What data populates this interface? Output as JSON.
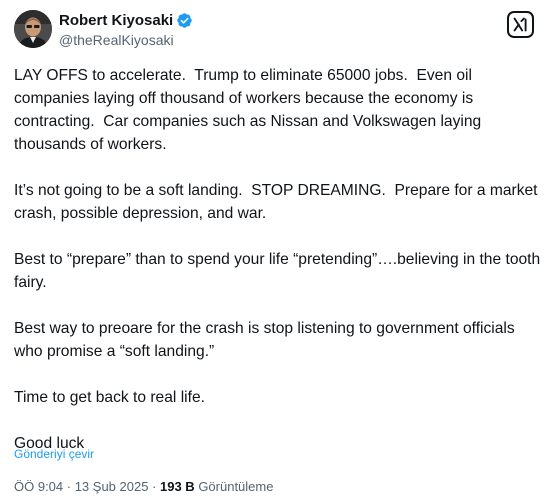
{
  "author": {
    "display_name": "Robert Kiyosaki",
    "handle": "@theRealKiyosaki",
    "verified_color": "#1d9bf0"
  },
  "header": {
    "grok_icon": "grok-icon"
  },
  "tweet": {
    "paragraphs": [
      "LAY OFFS to accelerate.  Trump to eliminate 65000 jobs.  Even oil companies laying off thousand of workers because the economy is contracting.  Car companies such as Nissan and Volkswagen laying thousands of workers.",
      "It’s not going to be a soft landing.  STOP DREAMING.  Prepare for a market crash, possible depression, and war.",
      "Best to “prepare” than to spend your life “pretending”….believing in the tooth fairy.",
      "Best way to preoare for the crash is stop listening to government officials who promise a “soft landing.”",
      "Time to get back to real life.",
      "Good luck"
    ],
    "translate_label": "Gönderiyi çevir"
  },
  "meta": {
    "time": "ÖÖ 9:04",
    "separator": " · ",
    "date": "13 Şub 2025",
    "views_count": "193 B",
    "views_label": " Görüntüleme"
  }
}
